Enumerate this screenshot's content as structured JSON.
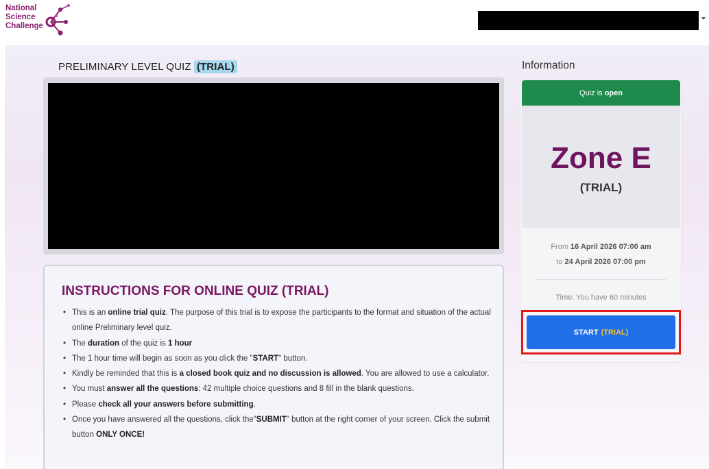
{
  "header": {
    "logo_lines": [
      "National",
      "Science",
      "Challenge"
    ],
    "user_name_redacted": true
  },
  "quiz": {
    "title": "PRELIMINARY LEVEL QUIZ",
    "title_badge": "(TRIAL)"
  },
  "instructions": {
    "heading": "INSTRUCTIONS FOR ONLINE QUIZ (TRIAL)",
    "items": [
      [
        {
          "t": "This is an "
        },
        {
          "t": "online trial quiz",
          "b": true
        },
        {
          "t": ". The purpose of this trial is to expose the participants to the format and situation of the actual online Preliminary level quiz."
        }
      ],
      [
        {
          "t": "The "
        },
        {
          "t": "duration",
          "b": true
        },
        {
          "t": " of the quiz is "
        },
        {
          "t": "1 hour",
          "b": true
        }
      ],
      [
        {
          "t": "The 1 hour time will begin as soon as you click the \""
        },
        {
          "t": "START",
          "b": true
        },
        {
          "t": "\" button."
        }
      ],
      [
        {
          "t": "Kindly be reminded that this is "
        },
        {
          "t": "a closed book quiz and no discussion is allowed",
          "b": true
        },
        {
          "t": ". You are allowed to use a calculator."
        }
      ],
      [
        {
          "t": "You must "
        },
        {
          "t": "answer all the questions",
          "b": true
        },
        {
          "t": ": 42 multiple choice questions and 8 fill in the blank questions."
        }
      ],
      [
        {
          "t": "Please "
        },
        {
          "t": "check all your answers before submitting",
          "b": true
        },
        {
          "t": "."
        }
      ],
      [
        {
          "t": "Once you have answered all the questions, click the\""
        },
        {
          "t": "SUBMIT",
          "b": true
        },
        {
          "t": "\" button at the right corner of your screen. Click the submit button "
        },
        {
          "t": "ONLY ONCE!",
          "b": true
        }
      ]
    ]
  },
  "info": {
    "title": "Information",
    "status_prefix": "Quiz is ",
    "status_value": "open",
    "zone": "Zone E",
    "zone_sub": "(TRIAL)",
    "from_label": "From ",
    "from_value": "16 April 2026 07:00 am",
    "to_label": "to ",
    "to_value": "24 April 2026 07:00 pm",
    "time_text": "Time: You have 60 minutes",
    "start_label": "START",
    "start_badge": "(TRIAL)"
  },
  "colors": {
    "brand": "#7b1661",
    "status_green": "#1e8b4c",
    "start_blue": "#1f6fe8",
    "highlight_red": "#e01919",
    "trial_highlight": "#a5d8ef"
  }
}
